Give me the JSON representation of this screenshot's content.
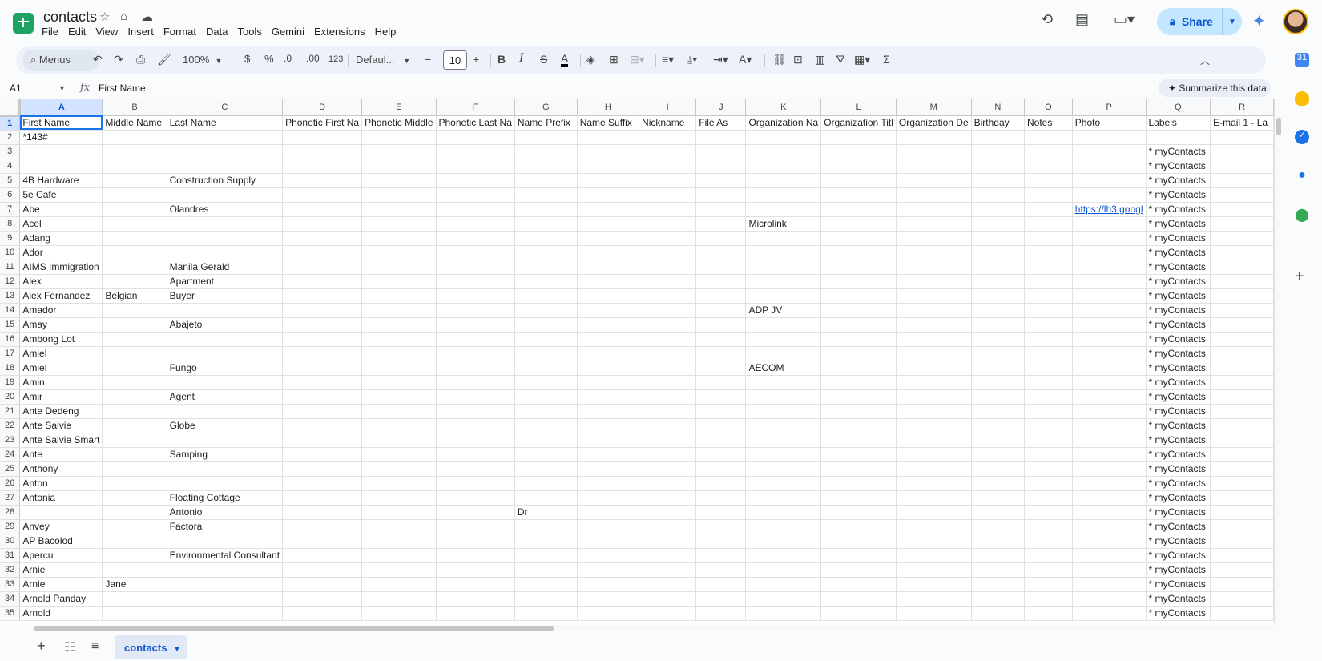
{
  "doc": {
    "title": "contacts"
  },
  "menu": [
    "File",
    "Edit",
    "View",
    "Insert",
    "Format",
    "Data",
    "Tools",
    "Gemini",
    "Extensions",
    "Help"
  ],
  "header": {
    "share_label": "Share"
  },
  "toolbar": {
    "menus_label": "Menus",
    "zoom": "100%",
    "currency": "$",
    "percent": "%",
    "dec_decrease": ".0",
    "dec_increase": ".00",
    "number_format": "123",
    "font": "Defaul...",
    "font_size": "10"
  },
  "formula_bar": {
    "cell_ref": "A1",
    "fx": "fx",
    "content": "First Name",
    "summarize_label": "Summarize this data"
  },
  "columns": [
    "A",
    "B",
    "C",
    "D",
    "E",
    "F",
    "G",
    "H",
    "I",
    "J",
    "K",
    "L",
    "M",
    "N",
    "O",
    "P",
    "Q",
    "R"
  ],
  "headers": [
    "First Name",
    "Middle Name",
    "Last Name",
    "Phonetic First Na",
    "Phonetic Middle",
    "Phonetic Last Na",
    "Name Prefix",
    "Name Suffix",
    "Nickname",
    "File As",
    "Organization Na",
    "Organization Titl",
    "Organization De",
    "Birthday",
    "Notes",
    "Photo",
    "Labels",
    "E-mail 1 - La"
  ],
  "rows": [
    {
      "n": "2",
      "first": "*143#",
      "middle": "",
      "last": "",
      "prefix": "",
      "org": "",
      "photo": "",
      "label": ""
    },
    {
      "n": "3",
      "first": "",
      "middle": "",
      "last": "",
      "prefix": "",
      "org": "",
      "photo": "",
      "label": "* myContacts"
    },
    {
      "n": "4",
      "first": "",
      "middle": "",
      "last": "",
      "prefix": "",
      "org": "",
      "photo": "",
      "label": "* myContacts"
    },
    {
      "n": "5",
      "first": "4B Hardware",
      "middle": "",
      "last": "Construction Supply",
      "prefix": "",
      "org": "",
      "photo": "",
      "label": "* myContacts"
    },
    {
      "n": "6",
      "first": "5e Cafe",
      "middle": "",
      "last": "",
      "prefix": "",
      "org": "",
      "photo": "",
      "label": "* myContacts"
    },
    {
      "n": "7",
      "first": "Abe",
      "middle": "",
      "last": "Olandres",
      "prefix": "",
      "org": "",
      "photo": "https://lh3.googl",
      "label": "* myContacts"
    },
    {
      "n": "8",
      "first": "Acel",
      "middle": "",
      "last": "",
      "prefix": "",
      "org": "Microlink",
      "photo": "",
      "label": "* myContacts"
    },
    {
      "n": "9",
      "first": "Adang",
      "middle": "",
      "last": "",
      "prefix": "",
      "org": "",
      "photo": "",
      "label": "* myContacts"
    },
    {
      "n": "10",
      "first": "Ador",
      "middle": "",
      "last": "",
      "prefix": "",
      "org": "",
      "photo": "",
      "label": "* myContacts"
    },
    {
      "n": "11",
      "first": "AIMS Immigration",
      "middle": "",
      "last": "Manila Gerald",
      "prefix": "",
      "org": "",
      "photo": "",
      "label": "* myContacts"
    },
    {
      "n": "12",
      "first": "Alex",
      "middle": "",
      "last": "Apartment",
      "prefix": "",
      "org": "",
      "photo": "",
      "label": "* myContacts"
    },
    {
      "n": "13",
      "first": "Alex Fernandez",
      "middle": "Belgian",
      "last": "Buyer",
      "prefix": "",
      "org": "",
      "photo": "",
      "label": "* myContacts"
    },
    {
      "n": "14",
      "first": "Amador",
      "middle": "",
      "last": "",
      "prefix": "",
      "org": "ADP JV",
      "photo": "",
      "label": "* myContacts"
    },
    {
      "n": "15",
      "first": "Amay",
      "middle": "",
      "last": "Abajeto",
      "prefix": "",
      "org": "",
      "photo": "",
      "label": "* myContacts"
    },
    {
      "n": "16",
      "first": "Ambong Lot",
      "middle": "",
      "last": "",
      "prefix": "",
      "org": "",
      "photo": "",
      "label": "* myContacts"
    },
    {
      "n": "17",
      "first": "Amiel",
      "middle": "",
      "last": "",
      "prefix": "",
      "org": "",
      "photo": "",
      "label": "* myContacts"
    },
    {
      "n": "18",
      "first": "Amiel",
      "middle": "",
      "last": "Fungo",
      "prefix": "",
      "org": "AECOM",
      "photo": "",
      "label": "* myContacts"
    },
    {
      "n": "19",
      "first": "Amin",
      "middle": "",
      "last": "",
      "prefix": "",
      "org": "",
      "photo": "",
      "label": "* myContacts"
    },
    {
      "n": "20",
      "first": "Amir",
      "middle": "",
      "last": "Agent",
      "prefix": "",
      "org": "",
      "photo": "",
      "label": "* myContacts"
    },
    {
      "n": "21",
      "first": "Ante Dedeng",
      "middle": "",
      "last": "",
      "prefix": "",
      "org": "",
      "photo": "",
      "label": "* myContacts"
    },
    {
      "n": "22",
      "first": "Ante Salvie",
      "middle": "",
      "last": "Globe",
      "prefix": "",
      "org": "",
      "photo": "",
      "label": "* myContacts"
    },
    {
      "n": "23",
      "first": "Ante Salvie Smart",
      "middle": "",
      "last": "",
      "prefix": "",
      "org": "",
      "photo": "",
      "label": "* myContacts"
    },
    {
      "n": "24",
      "first": "Ante",
      "middle": "",
      "last": "Samping",
      "prefix": "",
      "org": "",
      "photo": "",
      "label": "* myContacts"
    },
    {
      "n": "25",
      "first": "Anthony",
      "middle": "",
      "last": "",
      "prefix": "",
      "org": "",
      "photo": "",
      "label": "* myContacts"
    },
    {
      "n": "26",
      "first": "Anton",
      "middle": "",
      "last": "",
      "prefix": "",
      "org": "",
      "photo": "",
      "label": "* myContacts"
    },
    {
      "n": "27",
      "first": "Antonia",
      "middle": "",
      "last": "Floating Cottage",
      "prefix": "",
      "org": "",
      "photo": "",
      "label": "* myContacts"
    },
    {
      "n": "28",
      "first": "",
      "middle": "",
      "last": "Antonio",
      "prefix": "Dr",
      "org": "",
      "photo": "",
      "label": "* myContacts"
    },
    {
      "n": "29",
      "first": "Anvey",
      "middle": "",
      "last": "Factora",
      "prefix": "",
      "org": "",
      "photo": "",
      "label": "* myContacts"
    },
    {
      "n": "30",
      "first": "AP Bacolod",
      "middle": "",
      "last": "",
      "prefix": "",
      "org": "",
      "photo": "",
      "label": "* myContacts"
    },
    {
      "n": "31",
      "first": "Apercu",
      "middle": "",
      "last": "Environmental Consultant",
      "prefix": "",
      "org": "",
      "photo": "",
      "label": "* myContacts"
    },
    {
      "n": "32",
      "first": "Arnie",
      "middle": "",
      "last": "",
      "prefix": "",
      "org": "",
      "photo": "",
      "label": "* myContacts"
    },
    {
      "n": "33",
      "first": "Arnie",
      "middle": "Jane",
      "last": "",
      "prefix": "",
      "org": "",
      "photo": "",
      "label": "* myContacts"
    },
    {
      "n": "34",
      "first": "Arnold Panday",
      "middle": "",
      "last": "",
      "prefix": "",
      "org": "",
      "photo": "",
      "label": "* myContacts"
    },
    {
      "n": "35",
      "first": "Arnold",
      "middle": "",
      "last": "",
      "prefix": "",
      "org": "",
      "photo": "",
      "label": "* myContacts"
    }
  ],
  "sheets": [
    {
      "name": "contacts"
    }
  ]
}
